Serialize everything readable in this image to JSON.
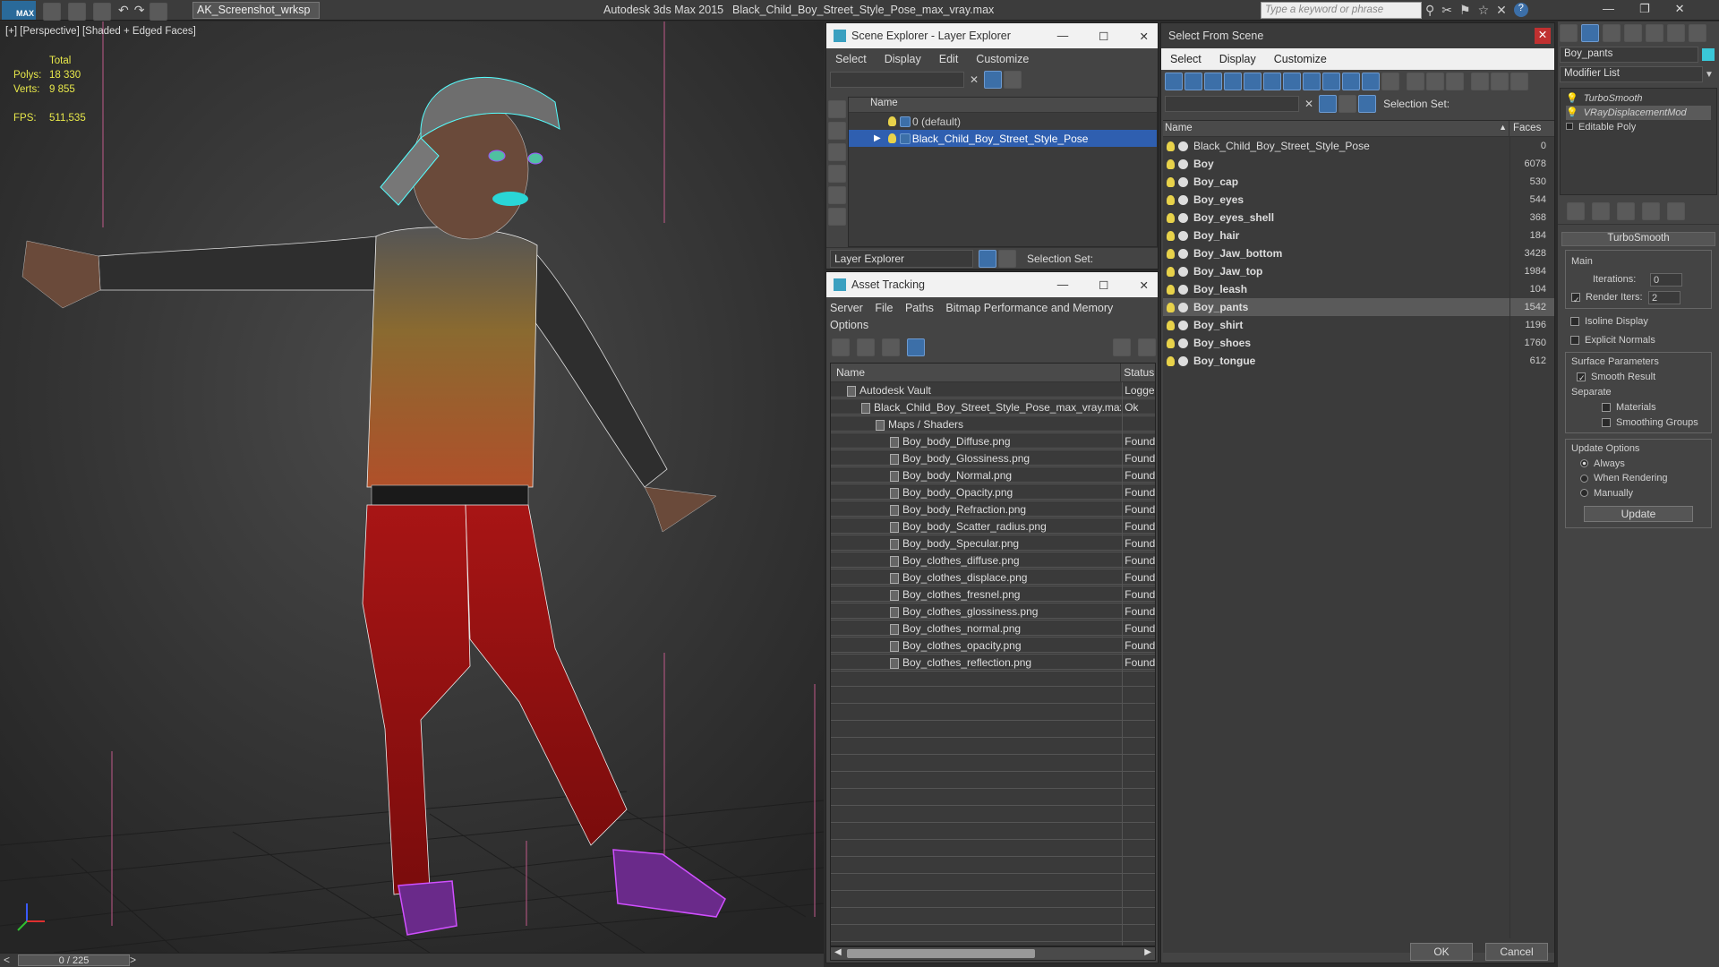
{
  "titlebar": {
    "app_logo": "MAX",
    "workspace": "AK_Screenshot_wrksp",
    "app_name": "Autodesk 3ds Max  2015",
    "file_name": "Black_Child_Boy_Street_Style_Pose_max_vray.max",
    "search_placeholder": "Type a keyword or phrase"
  },
  "viewport": {
    "label": "[+] [Perspective] [Shaded + Edged Faces]",
    "stats": {
      "total_label": "Total",
      "polys_label": "Polys:",
      "polys_value": "18 330",
      "verts_label": "Verts:",
      "verts_value": "9 855",
      "fps_label": "FPS:",
      "fps_value": "511,535"
    }
  },
  "timebar": {
    "frame": "0 / 225",
    "prev": "<",
    "next": ">"
  },
  "scene_explorer": {
    "title": "Scene Explorer - Layer Explorer",
    "menu": [
      "Select",
      "Display",
      "Edit",
      "Customize"
    ],
    "column": "Name",
    "rows": [
      "0 (default)",
      "Black_Child_Boy_Street_Style_Pose"
    ],
    "footer_dropdown": "Layer Explorer",
    "footer_selection": "Selection Set:"
  },
  "asset_tracking": {
    "title": "Asset Tracking",
    "menu": [
      "Server",
      "File",
      "Paths",
      "Bitmap Performance and Memory",
      "Options"
    ],
    "col_name": "Name",
    "col_status": "Status",
    "rows": [
      {
        "name": "Autodesk Vault",
        "status": "Logged",
        "indent": 0
      },
      {
        "name": "Black_Child_Boy_Street_Style_Pose_max_vray.max",
        "status": "Ok",
        "indent": 1
      },
      {
        "name": "Maps / Shaders",
        "status": "",
        "indent": 2
      },
      {
        "name": "Boy_body_Diffuse.png",
        "status": "Found",
        "indent": 3
      },
      {
        "name": "Boy_body_Glossiness.png",
        "status": "Found",
        "indent": 3
      },
      {
        "name": "Boy_body_Normal.png",
        "status": "Found",
        "indent": 3
      },
      {
        "name": "Boy_body_Opacity.png",
        "status": "Found",
        "indent": 3
      },
      {
        "name": "Boy_body_Refraction.png",
        "status": "Found",
        "indent": 3
      },
      {
        "name": "Boy_body_Scatter_radius.png",
        "status": "Found",
        "indent": 3
      },
      {
        "name": "Boy_body_Specular.png",
        "status": "Found",
        "indent": 3
      },
      {
        "name": "Boy_clothes_diffuse.png",
        "status": "Found",
        "indent": 3
      },
      {
        "name": "Boy_clothes_displace.png",
        "status": "Found",
        "indent": 3
      },
      {
        "name": "Boy_clothes_fresnel.png",
        "status": "Found",
        "indent": 3
      },
      {
        "name": "Boy_clothes_glossiness.png",
        "status": "Found",
        "indent": 3
      },
      {
        "name": "Boy_clothes_normal.png",
        "status": "Found",
        "indent": 3
      },
      {
        "name": "Boy_clothes_opacity.png",
        "status": "Found",
        "indent": 3
      },
      {
        "name": "Boy_clothes_reflection.png",
        "status": "Found",
        "indent": 3
      }
    ]
  },
  "select_from_scene": {
    "title": "Select From Scene",
    "menu": [
      "Select",
      "Display",
      "Customize"
    ],
    "selection_set": "Selection Set:",
    "col_name": "Name",
    "col_faces": "Faces",
    "rows": [
      {
        "name": "Black_Child_Boy_Street_Style_Pose",
        "faces": "0",
        "bold": false,
        "selected": false
      },
      {
        "name": "Boy",
        "faces": "6078",
        "bold": true,
        "selected": false
      },
      {
        "name": "Boy_cap",
        "faces": "530",
        "bold": true,
        "selected": false
      },
      {
        "name": "Boy_eyes",
        "faces": "544",
        "bold": true,
        "selected": false
      },
      {
        "name": "Boy_eyes_shell",
        "faces": "368",
        "bold": true,
        "selected": false
      },
      {
        "name": "Boy_hair",
        "faces": "184",
        "bold": true,
        "selected": false
      },
      {
        "name": "Boy_Jaw_bottom",
        "faces": "3428",
        "bold": true,
        "selected": false
      },
      {
        "name": "Boy_Jaw_top",
        "faces": "1984",
        "bold": true,
        "selected": false
      },
      {
        "name": "Boy_leash",
        "faces": "104",
        "bold": true,
        "selected": false
      },
      {
        "name": "Boy_pants",
        "faces": "1542",
        "bold": true,
        "selected": true
      },
      {
        "name": "Boy_shirt",
        "faces": "1196",
        "bold": true,
        "selected": false
      },
      {
        "name": "Boy_shoes",
        "faces": "1760",
        "bold": true,
        "selected": false
      },
      {
        "name": "Boy_tongue",
        "faces": "612",
        "bold": true,
        "selected": false
      }
    ],
    "ok": "OK",
    "cancel": "Cancel"
  },
  "modify_panel": {
    "object_name": "Boy_pants",
    "modifier_list": "Modifier List",
    "stack": [
      "TurboSmooth",
      "VRayDisplacementMod",
      "Editable Poly"
    ],
    "rollout_title": "TurboSmooth",
    "main_group": "Main",
    "iterations_label": "Iterations:",
    "iterations_value": "0",
    "render_iters_label": "Render Iters:",
    "render_iters_value": "2",
    "isoline_label": "Isoline Display",
    "explicit_normals_label": "Explicit Normals",
    "surface_group": "Surface Parameters",
    "smooth_result_label": "Smooth Result",
    "separate_label": "Separate",
    "materials_label": "Materials",
    "smoothing_groups_label": "Smoothing Groups",
    "update_group": "Update Options",
    "always_label": "Always",
    "when_rendering_label": "When Rendering",
    "manually_label": "Manually",
    "update_button": "Update"
  }
}
